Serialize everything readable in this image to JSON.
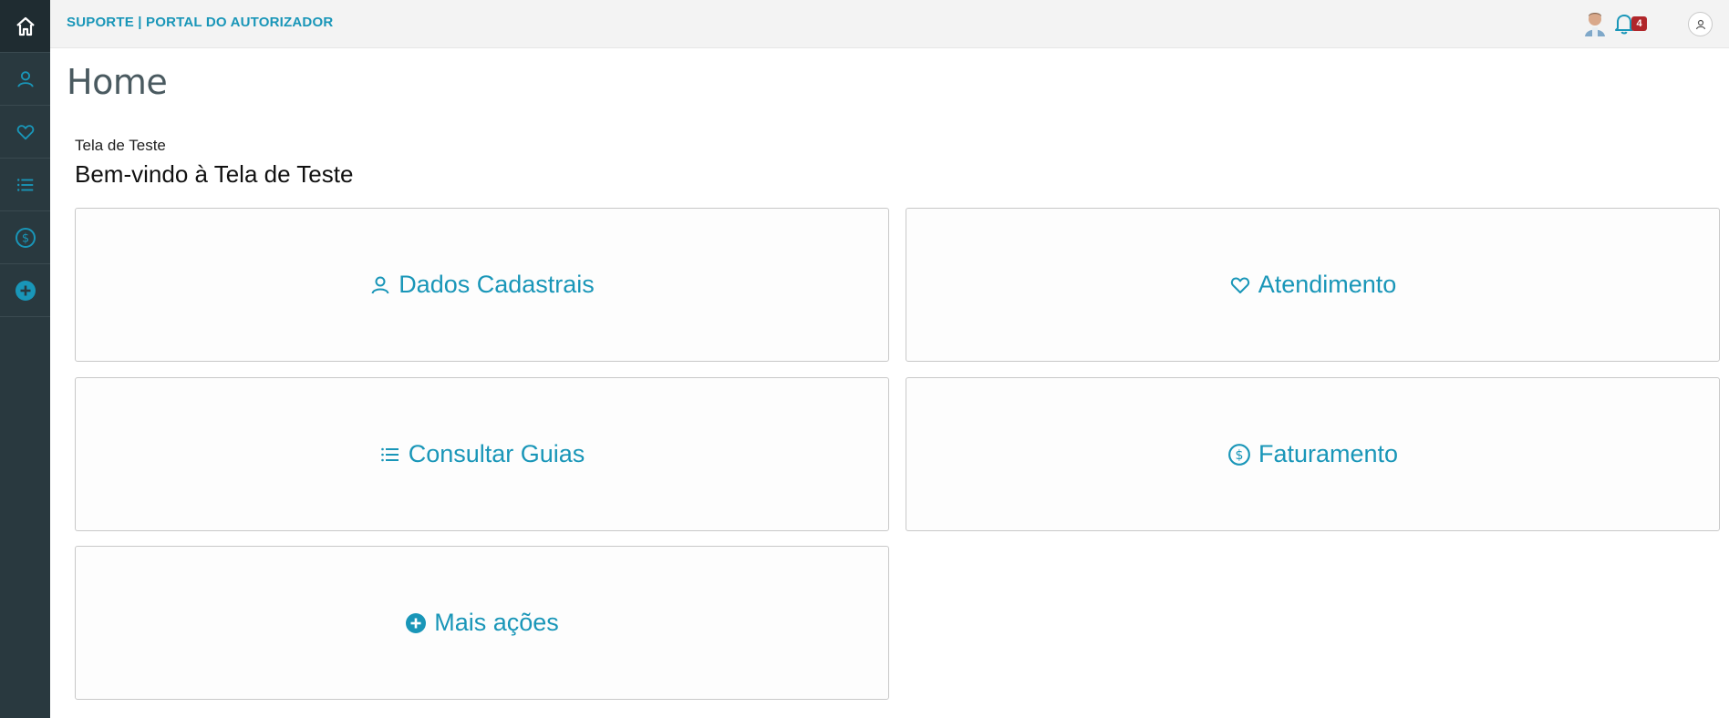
{
  "header": {
    "brand": "SUPORTE | PORTAL DO AUTORIZADOR",
    "notification_count": "4"
  },
  "sidebar": {
    "items": [
      {
        "icon": "home-icon"
      },
      {
        "icon": "user-icon"
      },
      {
        "icon": "heart-icon"
      },
      {
        "icon": "list-icon"
      },
      {
        "icon": "dollar-circle-icon"
      },
      {
        "icon": "plus-circle-icon"
      }
    ]
  },
  "page": {
    "title": "Home",
    "subtitle": "Tela de Teste",
    "welcome": "Bem-vindo à Tela de Teste"
  },
  "cards": {
    "dados": {
      "label": "Dados Cadastrais",
      "icon": "user-icon"
    },
    "atendimento": {
      "label": "Atendimento",
      "icon": "heart-icon"
    },
    "guias": {
      "label": "Consultar Guias",
      "icon": "list-icon"
    },
    "faturamento": {
      "label": "Faturamento",
      "icon": "dollar-circle-icon"
    },
    "mais": {
      "label": "Mais ações",
      "icon": "plus-circle-icon"
    }
  },
  "colors": {
    "accent": "#1996b8",
    "sidebar": "#29393f",
    "badge": "#b0262a"
  }
}
